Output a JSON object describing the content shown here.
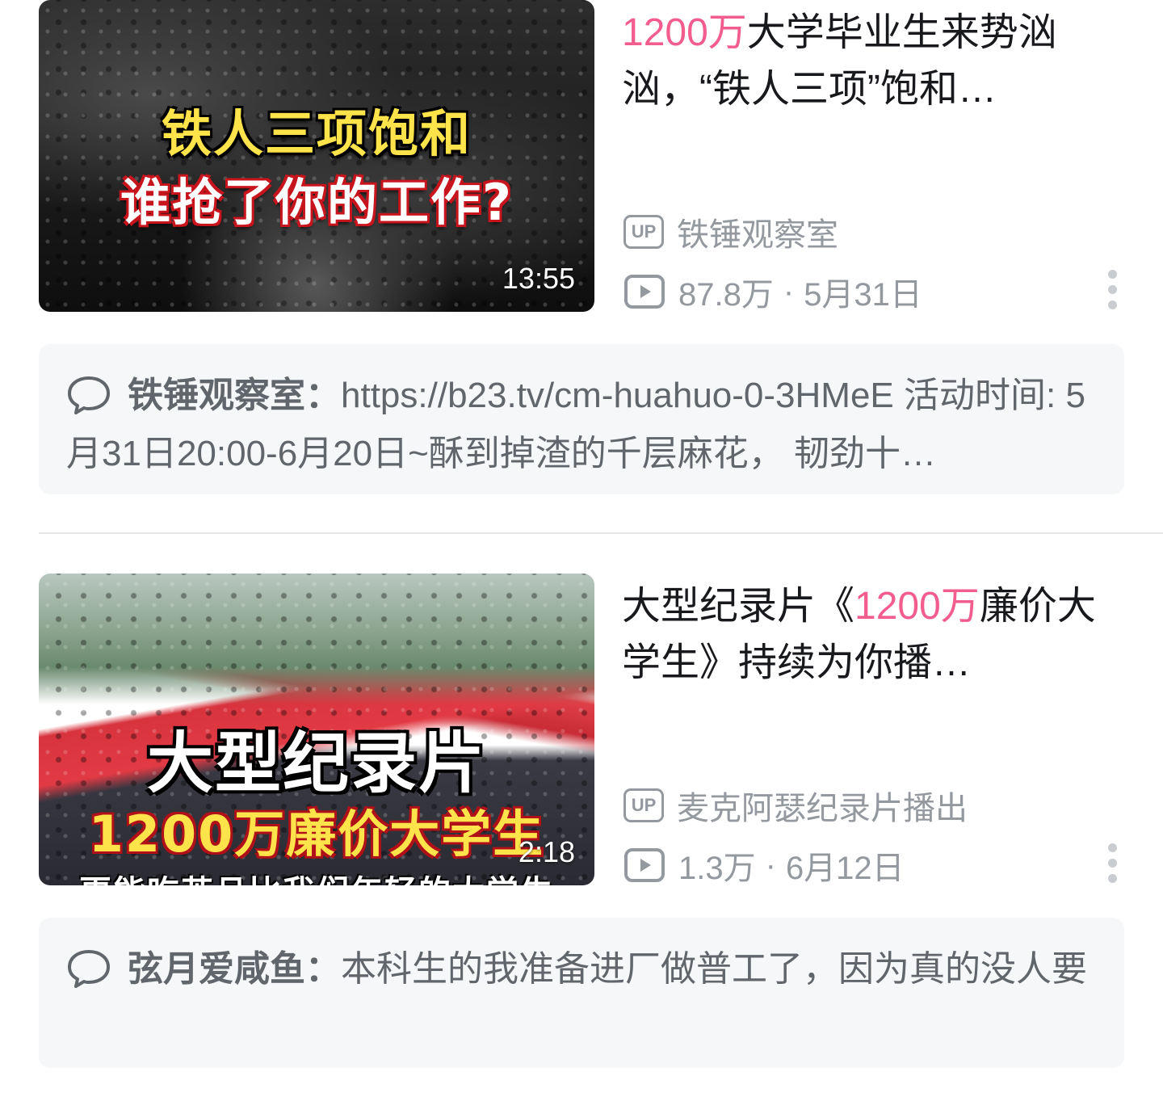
{
  "colors": {
    "highlight": "#f25d8e",
    "title_text": "#18191c",
    "meta_text": "#9499a0",
    "comment_bg": "#f6f7f8"
  },
  "videos": [
    {
      "thumbnail_caption_line1": "铁人三项饱和",
      "thumbnail_caption_line2": "谁抢了你的工作?",
      "duration": "13:55",
      "title_highlight": "1200万",
      "title_rest": "大学毕业生来势汹汹，“铁人三项”饱和…",
      "up_badge": "UP",
      "uploader": "铁锤观察室",
      "views": "87.8万",
      "separator": "·",
      "date": "5月31日",
      "comment_user": "铁锤观察室：",
      "comment_text": "https://b23.tv/cm-huahuo-0-3HMeE 活动时间: 5月31日20:00-6月20日~酥到掉渣的千层麻花， 韧劲十…"
    },
    {
      "thumbnail_caption_line1": "大型纪录片",
      "thumbnail_caption_line2": "1200万廉价大学生",
      "thumbnail_caption_line3": "更能吃苦且比我们年轻的大学生",
      "duration": "2:18",
      "title_prefix": "大型纪录片《",
      "title_highlight": "1200万",
      "title_rest": "廉价大学生》持续为你播…",
      "up_badge": "UP",
      "uploader": "麦克阿瑟纪录片播出",
      "views": "1.3万",
      "separator": "·",
      "date": "6月12日",
      "comment_user": "弦月爱咸鱼：",
      "comment_text": "本科生的我准备进厂做普工了，因为真的没人要"
    }
  ],
  "icons": {
    "up": "up-badge-icon",
    "play": "play-count-icon",
    "more": "more-vertical-icon",
    "comment": "comment-bubble-icon"
  }
}
